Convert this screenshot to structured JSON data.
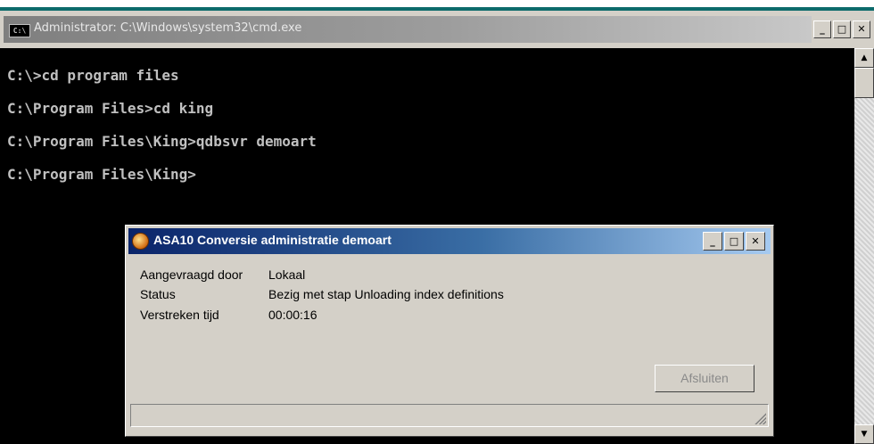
{
  "console": {
    "title": "Administrator: C:\\Windows\\system32\\cmd.exe",
    "icon_label": "C:\\",
    "lines": [
      "C:\\>cd program files",
      "C:\\Program Files>cd king",
      "C:\\Program Files\\King>qdbsvr demoart",
      "C:\\Program Files\\King>"
    ]
  },
  "dialog": {
    "title": "ASA10 Conversie administratie demoart",
    "fields": [
      {
        "label": "Aangevraagd door",
        "value": "Lokaal"
      },
      {
        "label": "Status",
        "value": "Bezig met stap Unloading index definitions"
      },
      {
        "label": "Verstreken tijd",
        "value": "00:00:16"
      }
    ],
    "close_button": "Afsluiten"
  },
  "window_controls": {
    "minimize": "_",
    "maximize": "□",
    "close": "✕"
  },
  "scroll": {
    "up": "▲",
    "down": "▼"
  },
  "colors": {
    "title_active": "#0a246a",
    "accent_teal": "#0c6b6b",
    "console_bg": "#000000",
    "console_text": "#c0c0c0"
  }
}
